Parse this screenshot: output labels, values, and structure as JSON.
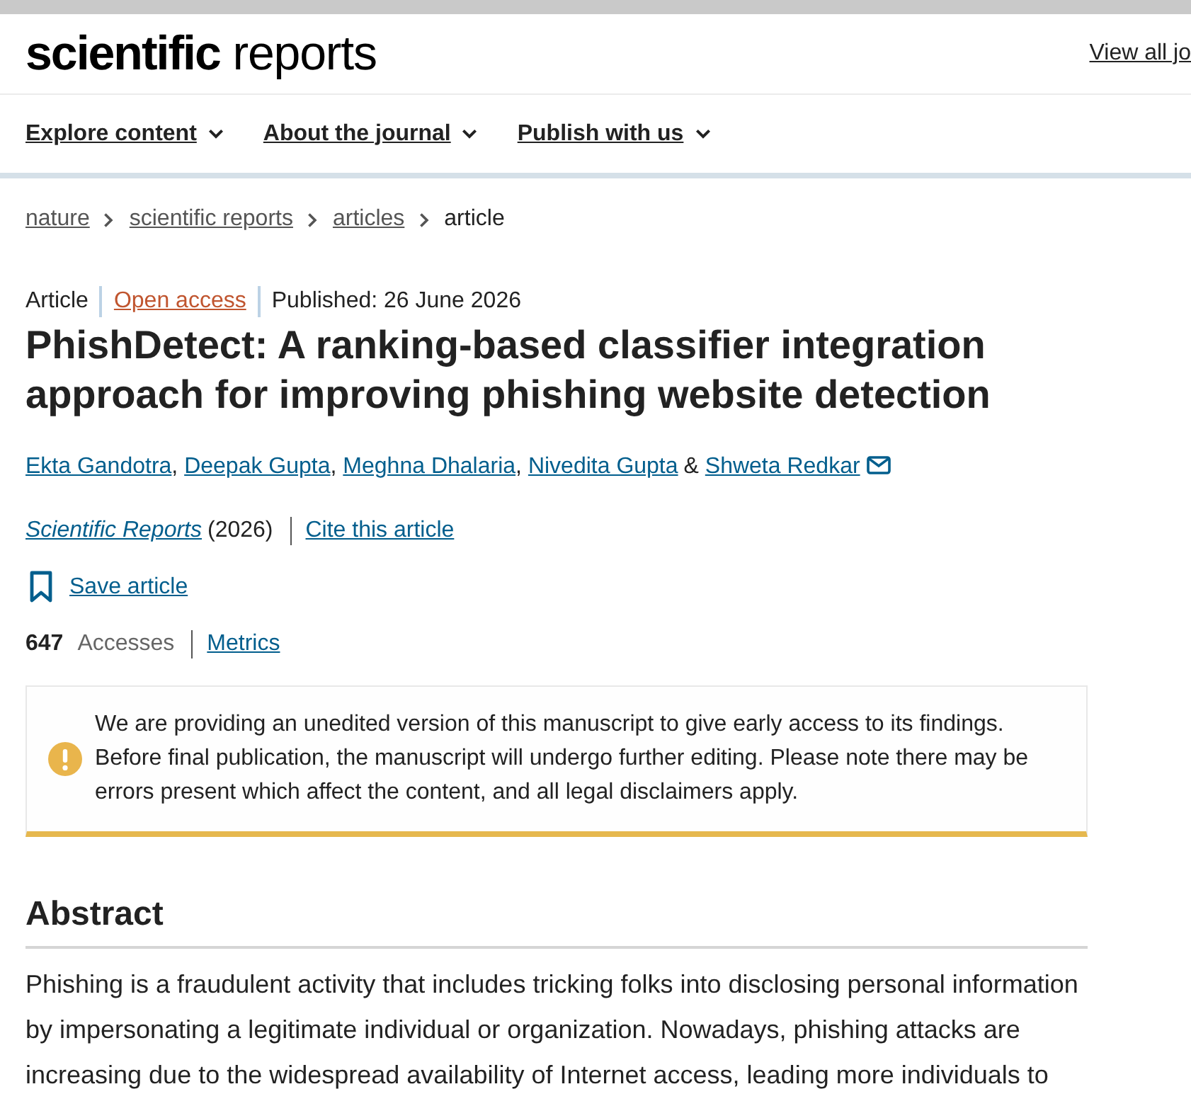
{
  "header": {
    "logo": {
      "bold": "scientific",
      "light": "reports"
    },
    "link": "View all jo"
  },
  "nav": [
    {
      "label": "Explore content",
      "expanded": false
    },
    {
      "label": "About the journal",
      "expanded": false
    },
    {
      "label": "Publish with us",
      "expanded": false
    }
  ],
  "breadcrumbs": [
    {
      "label": "nature",
      "kind": "link"
    },
    {
      "label": "scientific reports",
      "kind": "link"
    },
    {
      "label": "articles",
      "kind": "link"
    },
    {
      "label": "article",
      "kind": "current"
    }
  ],
  "article": {
    "type": "Article",
    "access": "Open access",
    "published": "Published: 26 June 2026",
    "title": "PhishDetect: A ranking-based classifier integration approach for improving phishing website detection",
    "authors": [
      {
        "name": "Ekta Gandotra",
        "separator": ",",
        "corresponding": false
      },
      {
        "name": "Deepak Gupta",
        "separator": ",",
        "corresponding": false
      },
      {
        "name": "Meghna Dhalaria",
        "separator": ",",
        "corresponding": false
      },
      {
        "name": "Nivedita Gupta",
        "separator": "&",
        "corresponding": false
      },
      {
        "name": "Shweta Redkar",
        "corresponding": true
      }
    ],
    "journal": "Scientific Reports",
    "year": "(2026)",
    "cite": "Cite this article",
    "save": "Save article",
    "accesses_count": "647",
    "accesses_label": "Accesses",
    "metrics": "Metrics"
  },
  "notice": {
    "text": "We are providing an unedited version of this manuscript to give early access to its findings. Before final publication, the manuscript will undergo further editing. Please note there may be errors present which affect the content, and all legal disclaimers apply."
  },
  "abstract": {
    "heading": "Abstract",
    "text": "Phishing is a fraudulent activity that includes tricking folks into disclosing personal information by impersonating a legitimate individual or organization. Nowadays, phishing attacks are increasing due to the widespread availability of Internet access, leading more individuals to"
  }
}
